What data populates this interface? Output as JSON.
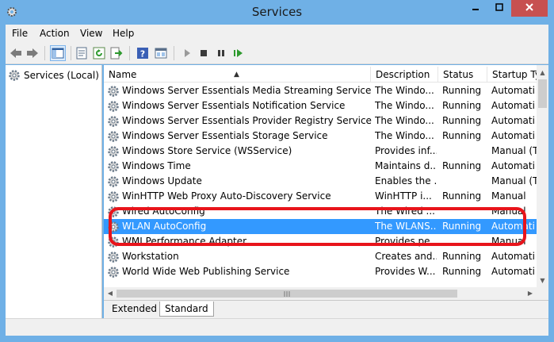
{
  "window": {
    "title": "Services"
  },
  "menu": {
    "file": "File",
    "action": "Action",
    "view": "View",
    "help": "Help"
  },
  "tree": {
    "root_label": "Services (Local)"
  },
  "table": {
    "columns": {
      "name": "Name",
      "description": "Description",
      "status": "Status",
      "startup": "Startup Ty"
    },
    "rows": [
      {
        "name": "Windows Server Essentials Media Streaming Service",
        "description": "The Windo...",
        "status": "Running",
        "startup": "Automati"
      },
      {
        "name": "Windows Server Essentials Notification Service",
        "description": "The Windo...",
        "status": "Running",
        "startup": "Automati"
      },
      {
        "name": "Windows Server Essentials Provider Registry Service",
        "description": "The Windo...",
        "status": "Running",
        "startup": "Automati"
      },
      {
        "name": "Windows Server Essentials Storage Service",
        "description": "The Windo...",
        "status": "Running",
        "startup": "Automati"
      },
      {
        "name": "Windows Store Service (WSService)",
        "description": "Provides inf...",
        "status": "",
        "startup": "Manual (T"
      },
      {
        "name": "Windows Time",
        "description": "Maintains d...",
        "status": "Running",
        "startup": "Automati"
      },
      {
        "name": "Windows Update",
        "description": "Enables the ...",
        "status": "",
        "startup": "Manual (T"
      },
      {
        "name": "WinHTTP Web Proxy Auto-Discovery Service",
        "description": "WinHTTP i...",
        "status": "Running",
        "startup": "Manual"
      },
      {
        "name": "Wired AutoConfig",
        "description": "The Wired ...",
        "status": "",
        "startup": "Manual"
      },
      {
        "name": "WLAN AutoConfig",
        "description": "The WLANS...",
        "status": "Running",
        "startup": "Automati"
      },
      {
        "name": "WMI Performance Adapter",
        "description": "Provides pe...",
        "status": "",
        "startup": "Manual"
      },
      {
        "name": "Workstation",
        "description": "Creates and...",
        "status": "Running",
        "startup": "Automati"
      },
      {
        "name": "World Wide Web Publishing Service",
        "description": "Provides W...",
        "status": "Running",
        "startup": "Automati"
      }
    ],
    "selected_row": "WLAN AutoConfig"
  },
  "tabs": {
    "extended": "Extended",
    "standard": "Standard"
  },
  "colors": {
    "titlebar": "#6fb0e6",
    "selection": "#3399ff",
    "highlight_outline": "#e8141b",
    "close_button": "#c75050"
  },
  "icons": [
    "back-icon",
    "forward-icon",
    "console-tree-icon",
    "properties-icon",
    "refresh-icon",
    "export-icon",
    "help-icon",
    "mmc-icon",
    "play-icon",
    "stop-icon",
    "pause-icon",
    "restart-icon",
    "gear-icon"
  ]
}
